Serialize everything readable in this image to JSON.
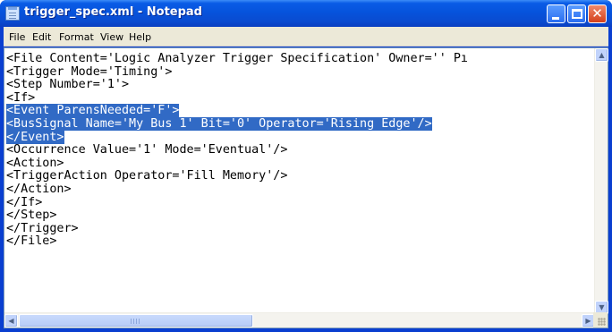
{
  "window": {
    "title": "trigger_spec.xml - Notepad"
  },
  "menu": [
    "File",
    "Edit",
    "Format",
    "View",
    "Help"
  ],
  "document": {
    "lines": [
      {
        "text": "<File Content='Logic Analyzer Trigger Specification' Owner='' Pı",
        "selected": false
      },
      {
        "text": "<Trigger Mode='Timing'>",
        "selected": false
      },
      {
        "text": "<Step Number='1'>",
        "selected": false
      },
      {
        "text": "<If>",
        "selected": false
      },
      {
        "text": "<Event ParensNeeded='F'>",
        "selected": true
      },
      {
        "text": "<BusSignal Name='My Bus 1' Bit='0' Operator='Rising Edge'/>",
        "selected": true
      },
      {
        "text": "</Event>",
        "selected": true
      },
      {
        "text": "<Occurrence Value='1' Mode='Eventual'/>",
        "selected": false
      },
      {
        "text": "<Action>",
        "selected": false
      },
      {
        "text": "<TriggerAction Operator='Fill Memory'/>",
        "selected": false
      },
      {
        "text": "</Action>",
        "selected": false
      },
      {
        "text": "</If>",
        "selected": false
      },
      {
        "text": "</Step>",
        "selected": false
      },
      {
        "text": "</Trigger>",
        "selected": false
      },
      {
        "text": "</File>",
        "selected": false
      }
    ]
  },
  "scrollbars": {
    "horizontal_position": 0.0,
    "vertical_position": 0.0
  },
  "colors": {
    "selection": "#316ac5",
    "titlebar": "#0653dc"
  }
}
